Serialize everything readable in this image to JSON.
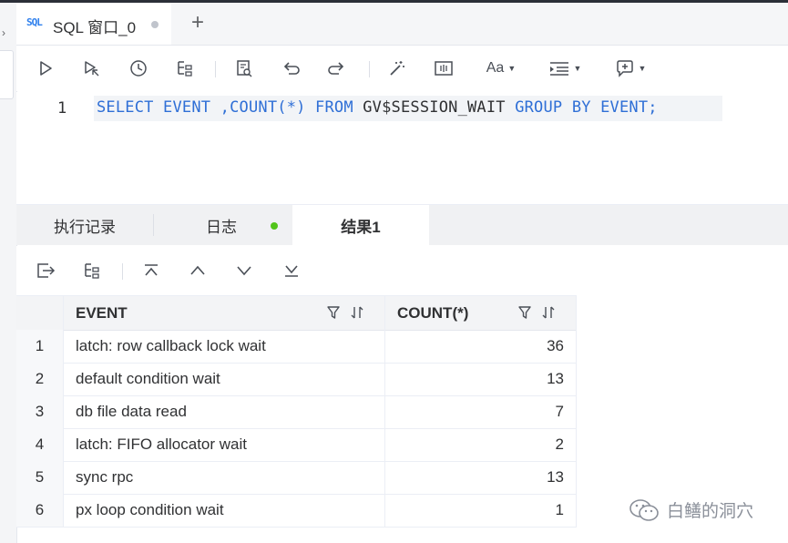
{
  "tab": {
    "sql_badge": "SQL",
    "title": "SQL 窗口_0"
  },
  "editor": {
    "line_number": "1",
    "tokens": [
      "SELECT",
      "EVENT",
      ",COUNT(*)",
      "FROM",
      "GV$SESSION_WAIT",
      "GROUP",
      "BY",
      "EVENT;"
    ]
  },
  "result_tabs": {
    "history": "执行记录",
    "log": "日志",
    "result": "结果1"
  },
  "toolbar": {
    "font_label": "Aa"
  },
  "grid": {
    "columns": [
      "EVENT",
      "COUNT(*)"
    ],
    "rows": [
      {
        "n": "1",
        "event": "latch: row callback lock wait",
        "count": "36"
      },
      {
        "n": "2",
        "event": "default condition wait",
        "count": "13"
      },
      {
        "n": "3",
        "event": "db file data read",
        "count": "7"
      },
      {
        "n": "4",
        "event": "latch: FIFO allocator wait",
        "count": "2"
      },
      {
        "n": "5",
        "event": "sync rpc",
        "count": "13"
      },
      {
        "n": "6",
        "event": "px loop condition wait",
        "count": "1"
      }
    ]
  },
  "watermark": {
    "text": "白鳝的洞穴"
  },
  "colors": {
    "keyword": "#2f6fd6",
    "active_dot": "#52c41a",
    "accent": "#2f80ed"
  }
}
